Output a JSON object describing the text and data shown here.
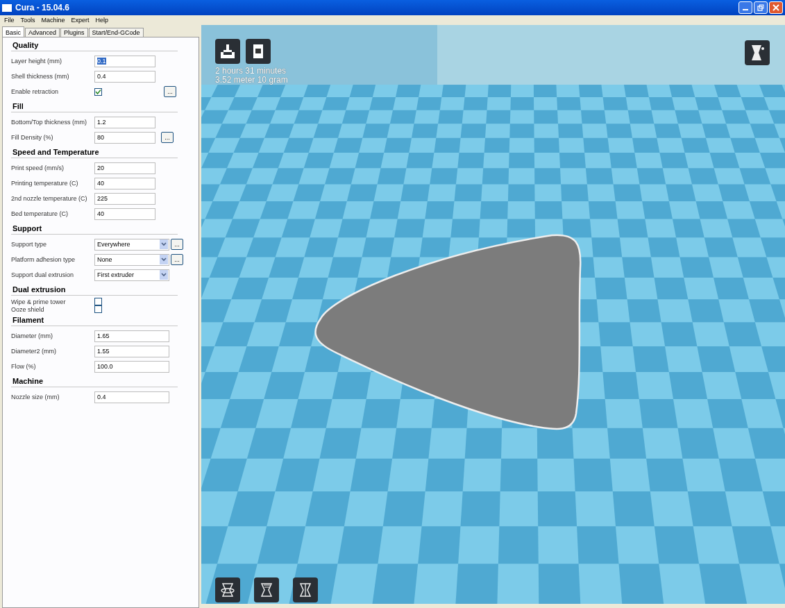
{
  "window": {
    "title": "Cura - 15.04.6"
  },
  "menu": [
    "File",
    "Tools",
    "Machine",
    "Expert",
    "Help"
  ],
  "tabs": [
    {
      "label": "Basic",
      "selected": true
    },
    {
      "label": "Advanced",
      "selected": false
    },
    {
      "label": "Plugins",
      "selected": false
    },
    {
      "label": "Start/End-GCode",
      "selected": false
    }
  ],
  "sections": [
    {
      "title": "Quality",
      "rows": [
        {
          "kind": "input",
          "label": "Layer height (mm)",
          "value": "0.1",
          "text_selected": true
        },
        {
          "kind": "input",
          "label": "Shell thickness (mm)",
          "value": "0.4",
          "text_selected": false
        },
        {
          "kind": "checkbox",
          "label": "Enable retraction",
          "checked": true,
          "button": "..."
        }
      ]
    },
    {
      "title": "Fill",
      "rows": [
        {
          "kind": "input",
          "label": "Bottom/Top thickness (mm)",
          "value": "1.2",
          "text_selected": false
        },
        {
          "kind": "input",
          "label": "Fill Density (%)",
          "value": "80",
          "text_selected": false,
          "button": "..."
        }
      ]
    },
    {
      "title": "Speed and Temperature",
      "rows": [
        {
          "kind": "input",
          "label": "Print speed (mm/s)",
          "value": "20",
          "text_selected": false
        },
        {
          "kind": "input",
          "label": "Printing temperature (C)",
          "value": "40",
          "text_selected": false
        },
        {
          "kind": "input",
          "label": "2nd nozzle temperature (C)",
          "value": "225",
          "text_selected": false
        },
        {
          "kind": "input",
          "label": "Bed temperature (C)",
          "value": "40",
          "text_selected": false
        }
      ]
    },
    {
      "title": "Support",
      "rows": [
        {
          "kind": "select",
          "label": "Support type",
          "value": "Everywhere",
          "button": "..."
        },
        {
          "kind": "select",
          "label": "Platform adhesion type",
          "value": "None",
          "button": "..."
        },
        {
          "kind": "select",
          "label": "Support dual extrusion",
          "value": "First extruder"
        }
      ]
    },
    {
      "title": "Dual extrusion",
      "rows": [
        {
          "kind": "compact-checkbox",
          "label": "Wipe & prime tower",
          "checked": false
        },
        {
          "kind": "compact-checkbox",
          "label": "Ooze shield",
          "checked": false
        }
      ]
    },
    {
      "title": "Filament",
      "rows": [
        {
          "kind": "wide-input",
          "label": "Diameter (mm)",
          "value": "1.65",
          "text_selected": false
        },
        {
          "kind": "wide-input",
          "label": "Diameter2 (mm)",
          "value": "1.55",
          "text_selected": false
        },
        {
          "kind": "wide-input",
          "label": "Flow (%)",
          "value": "100.0",
          "text_selected": false
        }
      ]
    },
    {
      "title": "Machine",
      "rows": [
        {
          "kind": "wide-input",
          "label": "Nozzle size (mm)",
          "value": "0.4",
          "text_selected": false
        }
      ]
    }
  ],
  "viewport": {
    "estimate": [
      "2 hours 31 minutes",
      "3.52 meter 10 gram"
    ]
  }
}
